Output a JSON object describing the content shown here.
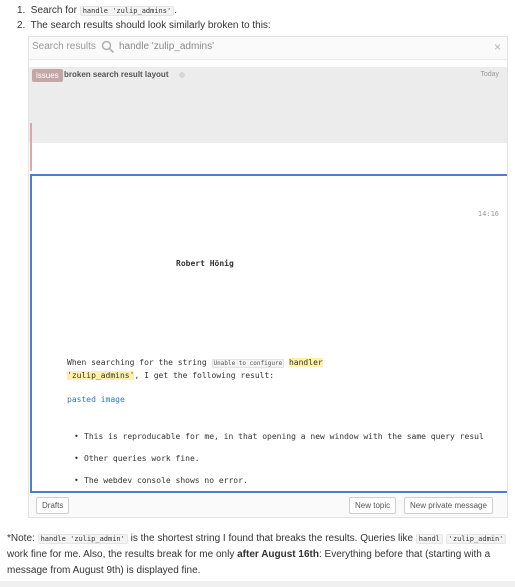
{
  "steps": [
    {
      "num": "1.",
      "before": "Search for",
      "code": "handle 'zulip_admins'",
      "after": "."
    },
    {
      "num": "2.",
      "text": "The search results should look similarly broken to this:"
    }
  ],
  "search": {
    "label": "Search results",
    "query": "handle 'zulip_admins'",
    "close": "×"
  },
  "recipient": {
    "stream": "issues",
    "topic": "broken search result layout",
    "date": "Today"
  },
  "message": {
    "time": "14:16",
    "sender": "Robert Hönig",
    "line1_text": "When searching for the string",
    "code1": "Unable to configure",
    "hl1": "handler",
    "hl2": "'zulip_admins'",
    "line2_rest": ", I get the following result:",
    "link": "pasted image",
    "bullets": [
      "This is reproducable for me, in that opening a new window with the same query resul",
      "Other queries work fine.",
      "The webdev console shows no error."
    ]
  },
  "compose": {
    "drafts": "Drafts",
    "new_topic": "New topic",
    "new_private": "New private message"
  },
  "note": {
    "p1": "*Note:",
    "code1": "handle 'zulip_admin'",
    "p2": "is the shortest string I found that breaks the results. Queries like",
    "code2": "handl",
    "code3": "'zulip_admin'",
    "p3": "work fine for me. Also, the results break for me only",
    "bold": "after August 16th",
    "p4": ": Everything before that (starting with a message from August 9th) is displayed fine."
  },
  "icons": {
    "search": "search-icon",
    "close": "close-icon"
  }
}
